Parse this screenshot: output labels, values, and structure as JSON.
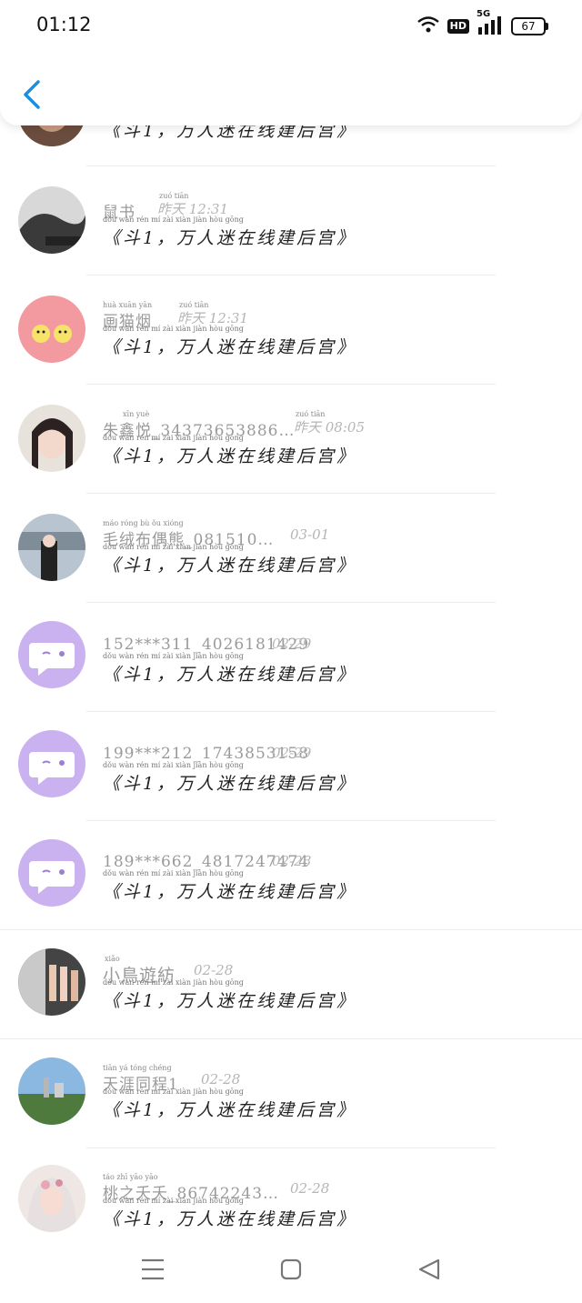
{
  "status_bar": {
    "time": "01:12",
    "network": "5G",
    "hd": "HD",
    "battery": "67"
  },
  "header": {
    "back_icon": "chevron-left-icon"
  },
  "conversations": [
    {
      "name": "",
      "name_pinyin": "",
      "time": "",
      "time_pinyin": "",
      "avatar": "photo-top-partial"
    },
    {
      "name": "鼠书",
      "name_pinyin": "",
      "time": "昨天 12:31",
      "time_pinyin": "zuó tiān",
      "avatar": "photo-bw"
    },
    {
      "name": "画猫烟",
      "name_pinyin": "huà xuān yān",
      "time": "昨天 12:31",
      "time_pinyin": "zuó tiān",
      "avatar": "chicks-pink"
    },
    {
      "name": "朱鑫悦_34373653886…",
      "name_pinyin": "xīn yuè",
      "time": "昨天 08:05",
      "time_pinyin": "zuó tiān",
      "avatar": "anime-girl"
    },
    {
      "name": "毛绒布偶熊_081510…",
      "name_pinyin": "máo róng bù ǒu xióng",
      "time": "03-01",
      "time_pinyin": "",
      "avatar": "photo-girl-city"
    },
    {
      "name": "152***311_4026181429",
      "name_pinyin": "",
      "time": "02-29",
      "time_pinyin": "",
      "avatar": "default-chat-bubble"
    },
    {
      "name": "199***212_1743853158",
      "name_pinyin": "",
      "time": "02-29",
      "time_pinyin": "",
      "avatar": "default-chat-bubble"
    },
    {
      "name": "189***662_4817247474",
      "name_pinyin": "",
      "time": "02-28",
      "time_pinyin": "",
      "avatar": "default-chat-bubble"
    },
    {
      "name": "小鳥遊紡",
      "name_pinyin": "xiǎo",
      "time": "02-28",
      "time_pinyin": "",
      "avatar": "photo-group"
    },
    {
      "name": "天涯同程1",
      "name_pinyin": "tiān yá tóng chéng",
      "time": "02-28",
      "time_pinyin": "",
      "avatar": "photo-landscape"
    },
    {
      "name": "桃之夭夭_86742243…",
      "name_pinyin": "táo zhī yāo yāo",
      "time": "02-28",
      "time_pinyin": "",
      "avatar": "anime-white-hair"
    }
  ],
  "message_text": "《斗1，万人迷在线建后宫》",
  "message_pinyin": "dǒu      wàn rén mí zài xiàn jiàn hòu gōng",
  "navbar": {
    "menu_icon": "menu-icon",
    "home_icon": "home-square-icon",
    "back_icon": "back-triangle-icon"
  }
}
